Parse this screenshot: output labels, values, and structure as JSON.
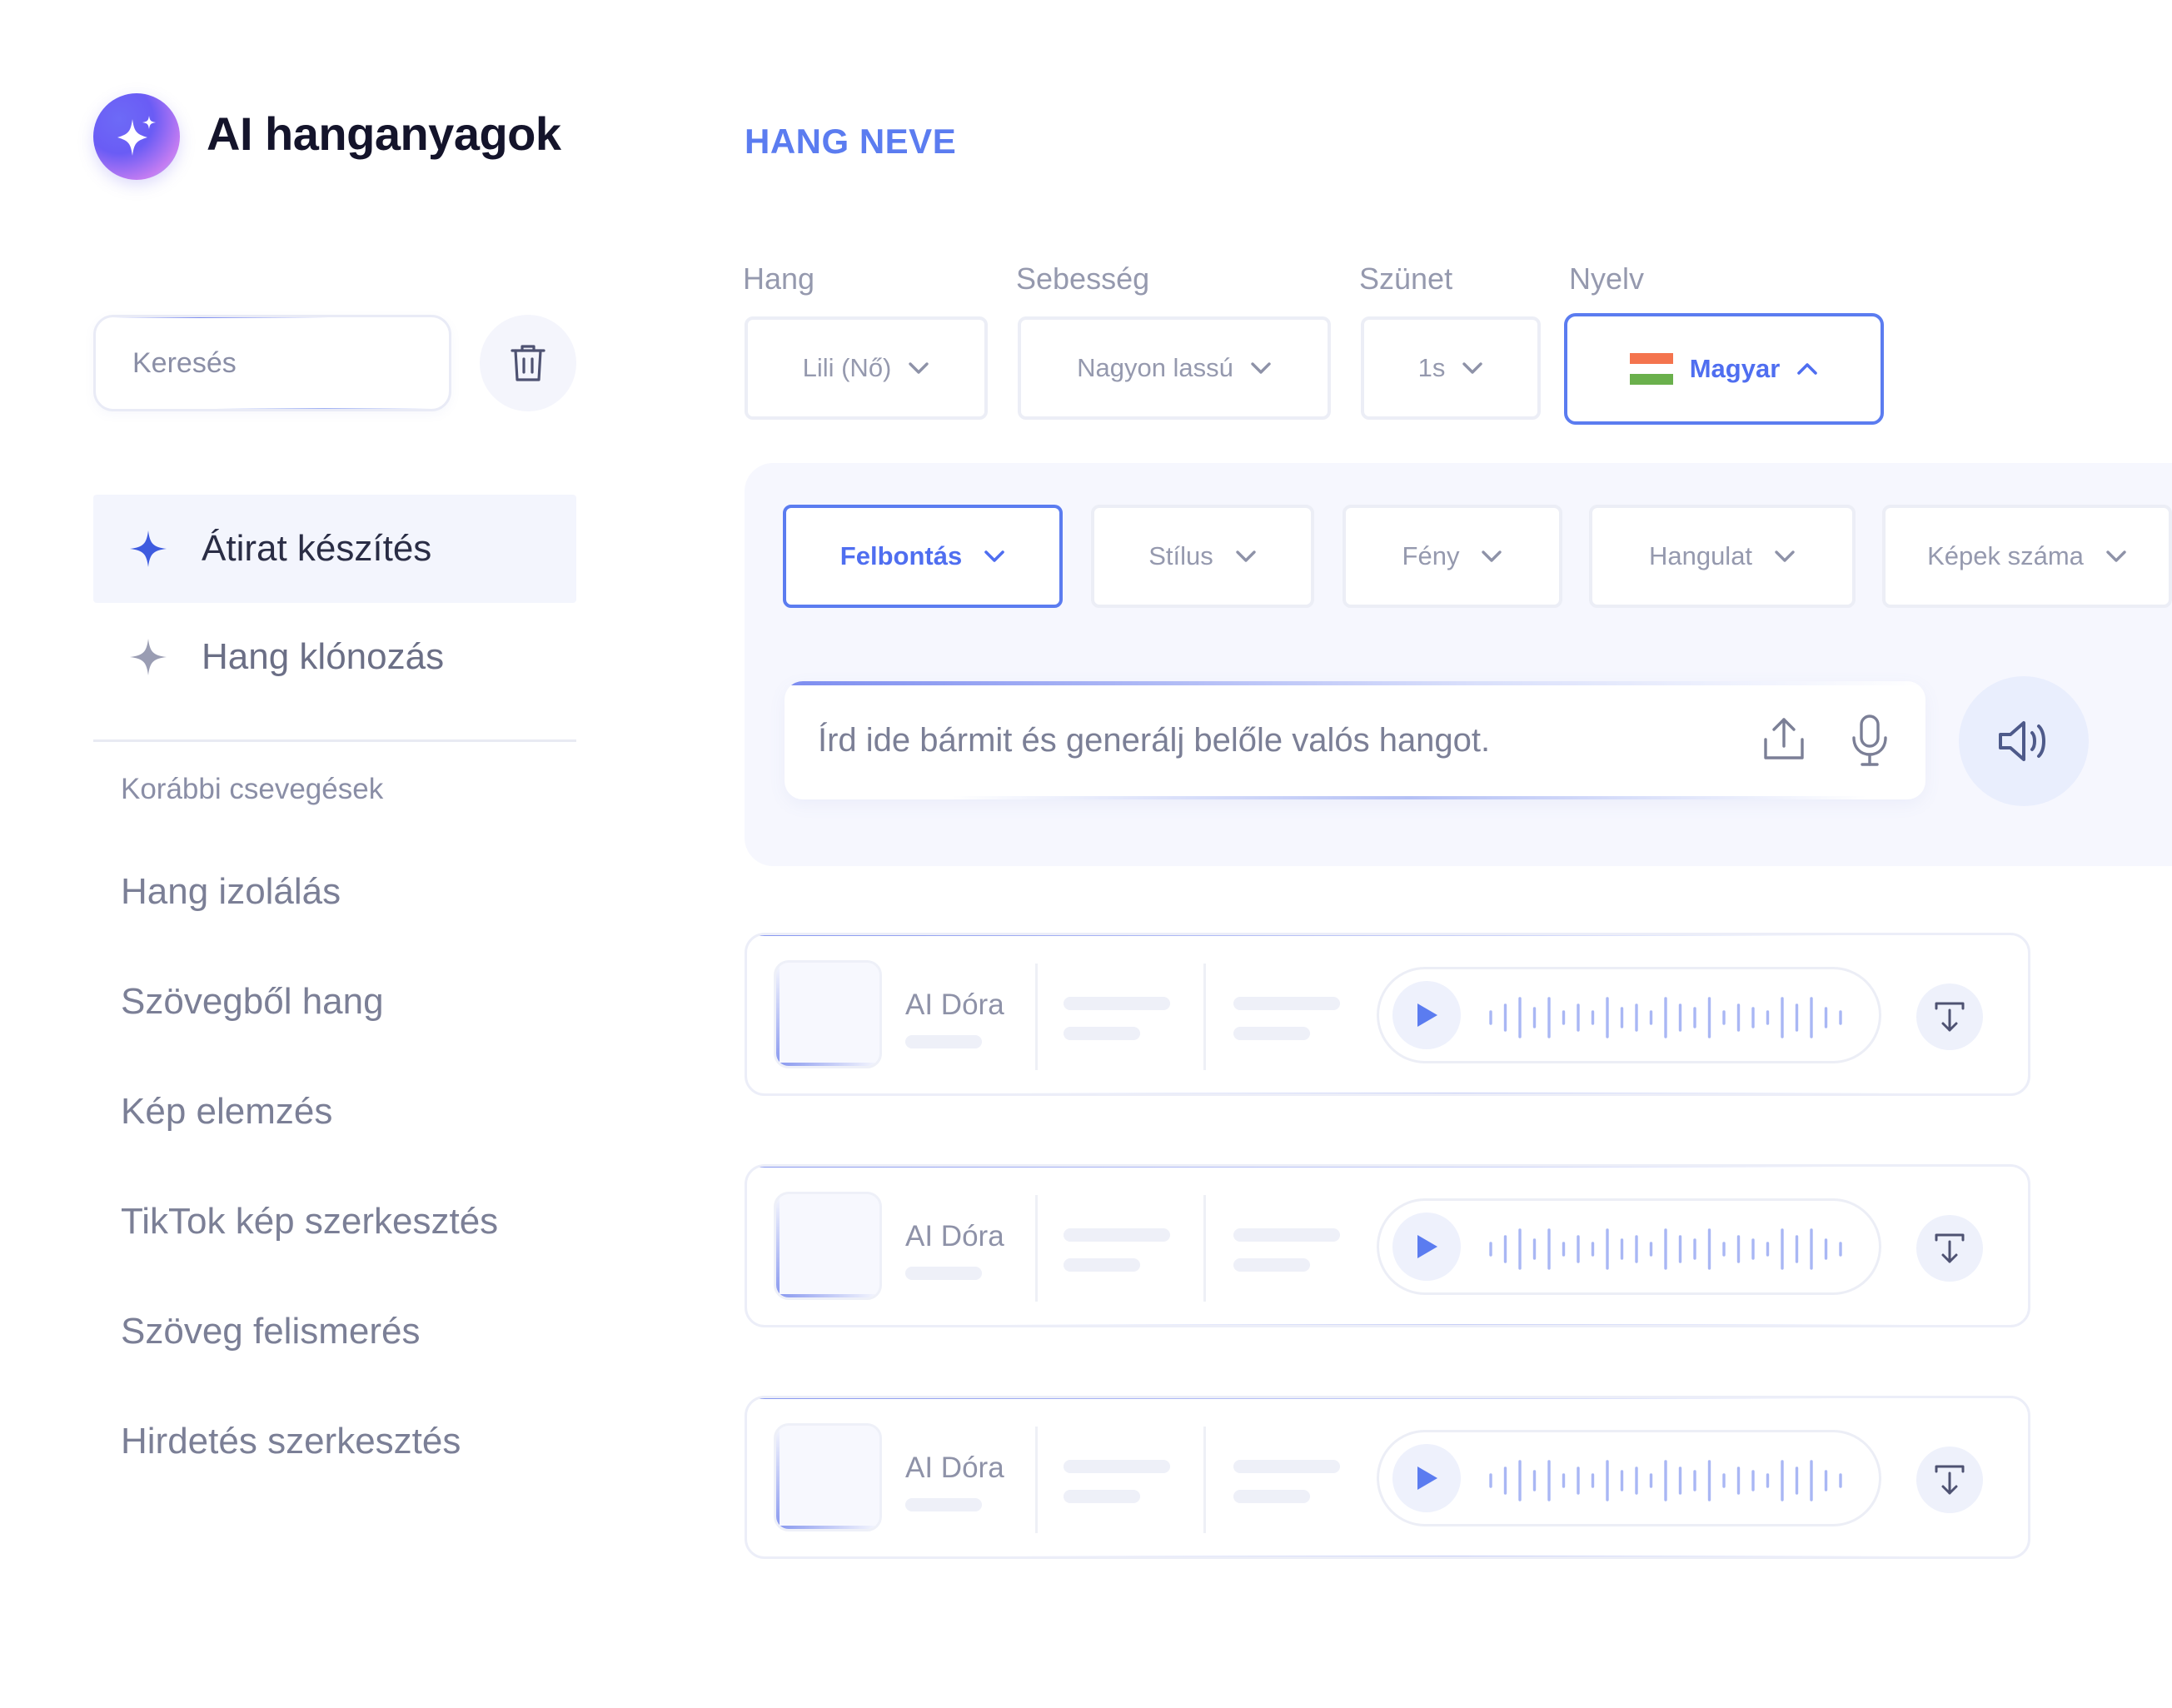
{
  "brand": {
    "title": "AI hanganyagok"
  },
  "search": {
    "placeholder": "Keresés"
  },
  "sidebar": {
    "items": [
      {
        "label": "Átirat készítés",
        "active": true
      },
      {
        "label": "Hang klónozás",
        "active": false
      }
    ],
    "history_label": "Korábbi csevegések",
    "history": [
      "Hang izolálás",
      "Szövegből hang",
      "Kép elemzés",
      "TikTok kép szerkesztés",
      "Szöveg felismerés",
      "Hirdetés szerkesztés"
    ]
  },
  "header": {
    "title": "HANG NEVE"
  },
  "settings": {
    "voice": {
      "label": "Hang",
      "value": "Lili (Nő)"
    },
    "speed": {
      "label": "Sebesség",
      "value": "Nagyon lassú"
    },
    "pause": {
      "label": "Szünet",
      "value": "1s"
    },
    "language": {
      "label": "Nyelv",
      "value": "Magyar"
    }
  },
  "filters": [
    "Felbontás",
    "Stílus",
    "Fény",
    "Hangulat",
    "Képek száma"
  ],
  "prompt": {
    "placeholder": "Írd ide bármit és generálj belőle valós hangot."
  },
  "results": [
    {
      "name": "AI Dóra"
    },
    {
      "name": "AI Dóra"
    },
    {
      "name": "AI Dóra"
    }
  ],
  "colors": {
    "accent": "#5b7cf0",
    "text_muted": "#8a8ea6",
    "panel_bg": "#f6f7fe"
  },
  "icons": {
    "brand": "sparkle-icon",
    "trash": "trash-icon",
    "nav": "star-icon",
    "chevron": "chevron-down-icon",
    "chevron_up": "chevron-up-icon",
    "upload": "upload-icon",
    "mic": "microphone-icon",
    "speaker": "speaker-icon",
    "play": "play-icon",
    "download": "download-icon"
  }
}
